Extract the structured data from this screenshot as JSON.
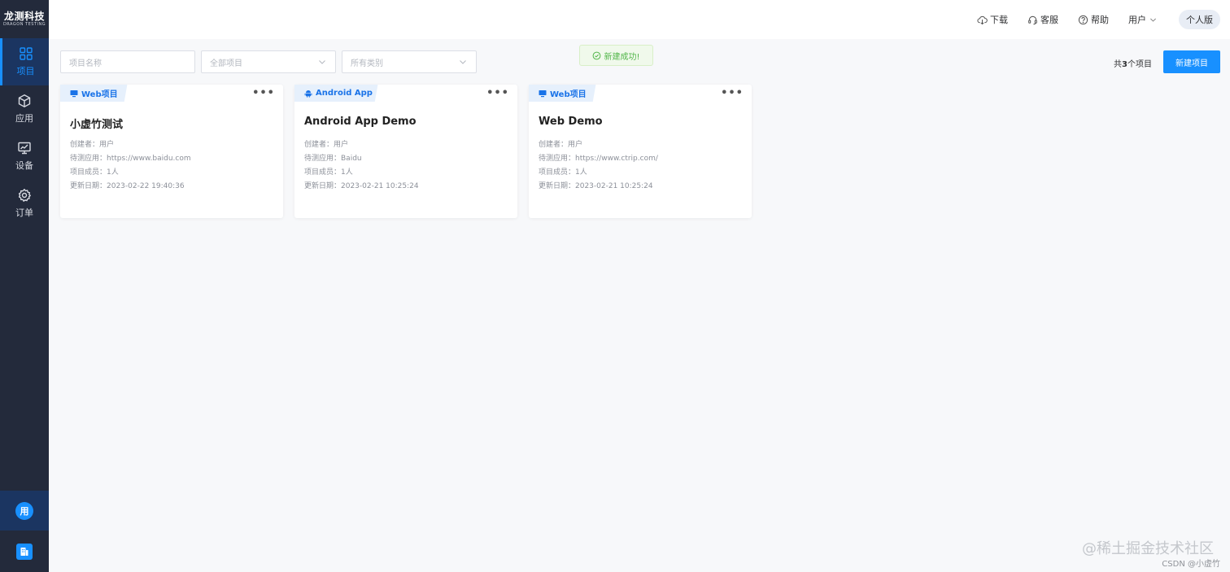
{
  "sidebar": {
    "logo_title": "龙测科技",
    "logo_sub": "DRAGON TESTING",
    "items": [
      {
        "label": "项目",
        "icon": "grid-icon",
        "active": true
      },
      {
        "label": "应用",
        "icon": "cube-icon",
        "active": false
      },
      {
        "label": "设备",
        "icon": "monitor-icon",
        "active": false
      },
      {
        "label": "订单",
        "icon": "gear-icon",
        "active": false
      }
    ],
    "avatar_text": "用",
    "bottom_icon": "document-icon"
  },
  "header": {
    "download": "下载",
    "service": "客服",
    "help": "帮助",
    "user": "用户",
    "edition": "个人版"
  },
  "toolbar": {
    "name_placeholder": "项目名称",
    "project_filter": "全部项目",
    "type_filter": "所有类别",
    "count_prefix": "共",
    "count": "3",
    "count_suffix": "个项目",
    "new_button": "新建项目"
  },
  "toast": "新建成功!",
  "cards": [
    {
      "tag": "Web项目",
      "tag_icon": "monitor-icon",
      "title": "小虚竹测试",
      "creator": "创建者：用户",
      "app": "待测应用：https://www.baidu.com",
      "members": "项目成员：1人",
      "updated": "更新日期：2023-02-22 19:40:36"
    },
    {
      "tag": "Android App",
      "tag_icon": "android-icon",
      "title": "Android App Demo",
      "creator": "创建者：用户",
      "app": "待测应用：Baidu",
      "members": "项目成员：1人",
      "updated": "更新日期：2023-02-21 10:25:24"
    },
    {
      "tag": "Web项目",
      "tag_icon": "monitor-icon",
      "title": "Web Demo",
      "creator": "创建者：用户",
      "app": "待测应用：https://www.ctrip.com/",
      "members": "项目成员：1人",
      "updated": "更新日期：2023-02-21 10:25:24"
    }
  ],
  "watermark": "@稀土掘金技术社区",
  "credit": "CSDN @小虚竹",
  "colors": {
    "primary": "#1890ff",
    "sidebar": "#232a3b",
    "success": "#52b64a"
  }
}
